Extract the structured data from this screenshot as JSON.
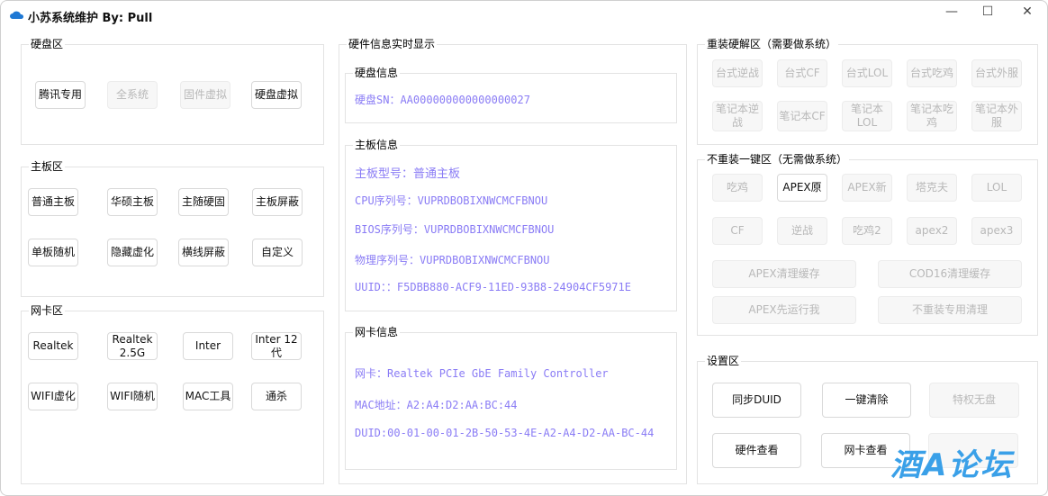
{
  "window": {
    "title": "小苏系统维护 By:  Pull",
    "controls": [
      "—",
      "☐",
      "✕"
    ]
  },
  "left": {
    "disk": {
      "title": "硬盘区",
      "buttons": [
        {
          "label": "腾讯专用"
        },
        {
          "label": "全系统",
          "disabled": true
        },
        {
          "label": "固件虚拟",
          "disabled": true
        },
        {
          "label": "硬盘虚拟"
        }
      ]
    },
    "board": {
      "title": "主板区",
      "buttons": [
        {
          "label": "普通主板"
        },
        {
          "label": "华硕主板"
        },
        {
          "label": "主随硬固"
        },
        {
          "label": "主板屏蔽"
        },
        {
          "label": "单板随机"
        },
        {
          "label": "隐藏虚化"
        },
        {
          "label": "横线屏蔽"
        },
        {
          "label": "自定义"
        }
      ]
    },
    "nic": {
      "title": "网卡区",
      "buttons": [
        {
          "label": "Realtek"
        },
        {
          "label": "Realtek 2.5G"
        },
        {
          "label": "Inter"
        },
        {
          "label": "Inter 12代"
        },
        {
          "label": "WIFI虚化"
        },
        {
          "label": "WIFI随机"
        },
        {
          "label": "MAC工具"
        },
        {
          "label": "通杀"
        }
      ]
    }
  },
  "middle": {
    "title": "硬件信息实时显示",
    "disk": {
      "title": "硬盘信息",
      "lines": [
        "硬盘SN：AA000000000000000027"
      ]
    },
    "board": {
      "title": "主板信息",
      "lines": [
        "主板型号：普通主板",
        "CPU序列号：VUPRDBOBIXNWCMCFBNOU",
        "BIOS序列号：VUPRDBOBIXNWCMCFBNOU",
        "物理序列号：VUPRDBOBIXNWCMCFBNOU",
        "UUID：：F5DBB880-ACF9-11ED-93B8-24904CF5971E"
      ]
    },
    "nic": {
      "title": "网卡信息",
      "lines": [
        "网卡：Realtek PCIe GbE Family Controller",
        "MAC地址：A2:A4:D2:AA:BC:44",
        "DUID:00-01-00-01-2B-50-53-4E-A2-A4-D2-AA-BC-44"
      ]
    },
    "info_color": "#8a7cf5"
  },
  "right": {
    "reinstall": {
      "title": "重装硬解区（需要做系统）",
      "buttons": [
        {
          "label": "台式逆战",
          "disabled": true
        },
        {
          "label": "台式CF",
          "disabled": true
        },
        {
          "label": "台式LOL",
          "disabled": true
        },
        {
          "label": "台式吃鸡",
          "disabled": true
        },
        {
          "label": "台式外服",
          "disabled": true
        },
        {
          "label": "笔记本逆战",
          "disabled": true
        },
        {
          "label": "笔记本CF",
          "disabled": true
        },
        {
          "label": "笔记本LOL",
          "disabled": true
        },
        {
          "label": "笔记本吃鸡",
          "disabled": true
        },
        {
          "label": "笔记本外服",
          "disabled": true
        }
      ]
    },
    "noreinstall": {
      "title": "不重装一键区（无需做系统）",
      "buttons": [
        {
          "label": "吃鸡",
          "disabled": true
        },
        {
          "label": "APEX原"
        },
        {
          "label": "APEX新",
          "disabled": true
        },
        {
          "label": "塔克夫",
          "disabled": true
        },
        {
          "label": "LOL",
          "disabled": true
        },
        {
          "label": "CF",
          "disabled": true
        },
        {
          "label": "逆战",
          "disabled": true
        },
        {
          "label": "吃鸡2",
          "disabled": true
        },
        {
          "label": "apex2",
          "disabled": true
        },
        {
          "label": "apex3",
          "disabled": true
        },
        {
          "label": "APEX清理缓存",
          "disabled": true
        },
        {
          "label": "COD16清理缓存",
          "disabled": true
        },
        {
          "label": "APEX先运行我",
          "disabled": true
        },
        {
          "label": "不重装专用清理",
          "disabled": true
        }
      ]
    },
    "settings": {
      "title": "设置区",
      "buttons": [
        {
          "label": "同步DUID"
        },
        {
          "label": "一键清除"
        },
        {
          "label": "特权无盘",
          "disabled": true
        },
        {
          "label": "硬件查看"
        },
        {
          "label": "网卡查看"
        },
        {
          "label": "",
          "disabled": true
        }
      ]
    }
  },
  "watermark": "酒A论坛"
}
